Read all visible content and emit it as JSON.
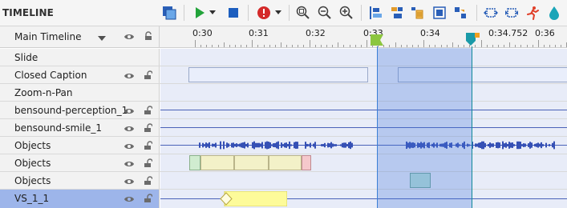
{
  "panel": {
    "title": "TIMELINE"
  },
  "header": {
    "main_timeline_label": "Main Timeline"
  },
  "ruler": {
    "labels": [
      "0:30",
      "0:31",
      "0:32",
      "0:33",
      "0:34",
      "0:34.752",
      "0:36"
    ]
  },
  "tracks": [
    {
      "label": "Slide",
      "has_icons": false
    },
    {
      "label": "Closed Caption",
      "has_icons": true
    },
    {
      "label": "Zoom-n-Pan",
      "has_icons": false
    },
    {
      "label": "bensound-perception_1",
      "has_icons": true
    },
    {
      "label": "bensound-smile_1",
      "has_icons": true
    },
    {
      "label": "Objects",
      "has_icons": true
    },
    {
      "label": "Objects",
      "has_icons": true
    },
    {
      "label": "Objects",
      "has_icons": true
    },
    {
      "label": "VS_1_1",
      "has_icons": true,
      "selected": true
    }
  ],
  "toolbar_icons": [
    "layout-icon",
    "play-icon",
    "play-dropdown-icon",
    "stop-icon",
    "record-icon",
    "record-dropdown-icon",
    "zoom-fit-icon",
    "zoom-out-icon",
    "zoom-in-icon",
    "align-start-icon",
    "align-move-icon",
    "delete-icon",
    "fit-icon",
    "split-icon",
    "expand-icon",
    "collapse-icon",
    "run-icon",
    "drop-icon"
  ],
  "colors": {
    "accent_blue": "#3b7fd6",
    "play_green": "#22a33a",
    "stop_blue": "#1d5fbf",
    "record_red": "#d42a2a",
    "selection": "#9db5ea",
    "marker_green": "#8cc63f",
    "marker_teal": "#1a9aa8",
    "clip_yellow": "#fdfb9a"
  }
}
